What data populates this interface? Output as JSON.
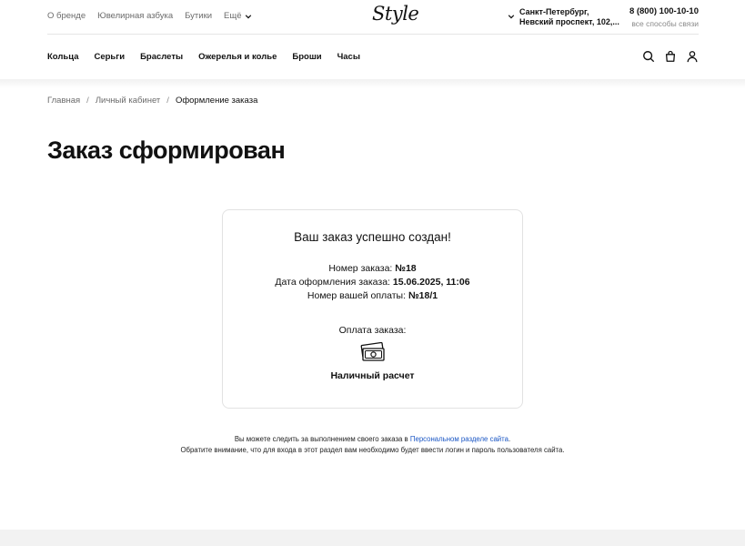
{
  "topbar": {
    "links": [
      "О бренде",
      "Ювелирная азбука",
      "Бутики"
    ],
    "more_label": "Ещё",
    "logo": "Style",
    "city_line1": "Санкт-Петербург,",
    "city_line2": "Невский проспект, 102,...",
    "phone": "8 (800) 100-10-10",
    "contacts": "все способы связи"
  },
  "nav": {
    "items": [
      "Кольца",
      "Серьги",
      "Браслеты",
      "Ожерелья и колье",
      "Броши",
      "Часы"
    ],
    "icons": [
      "search-icon",
      "cart-icon",
      "user-icon"
    ]
  },
  "breadcrumb": {
    "home": "Главная",
    "account": "Личный кабинет",
    "current": "Оформление заказа",
    "separator": "/"
  },
  "page": {
    "title": "Заказ сформирован"
  },
  "order": {
    "heading": "Ваш заказ успешно создан!",
    "number_label": "Номер заказа:",
    "number_value": "№18",
    "date_label": "Дата оформления заказа:",
    "date_value": "15.06.2025, 11:06",
    "payment_no_label": "Номер вашей оплаты:",
    "payment_no_value": "№18/1",
    "payment_label": "Оплата заказа:",
    "payment_icon": "cash-icon",
    "payment_method": "Наличный расчет"
  },
  "note": {
    "line1_before": "Вы можете следить за выполнением своего заказа в",
    "line1_link": "Персональном разделе сайта",
    "line1_after": ".",
    "line2": "Обратите внимание, что для входа в этот раздел вам необходимо будет ввести логин и пароль пользователя сайта."
  },
  "colors": {
    "link": "#1a56c4",
    "text": "#111111",
    "muted": "#6b6b6b",
    "footer_band": "#f2f2f2"
  }
}
